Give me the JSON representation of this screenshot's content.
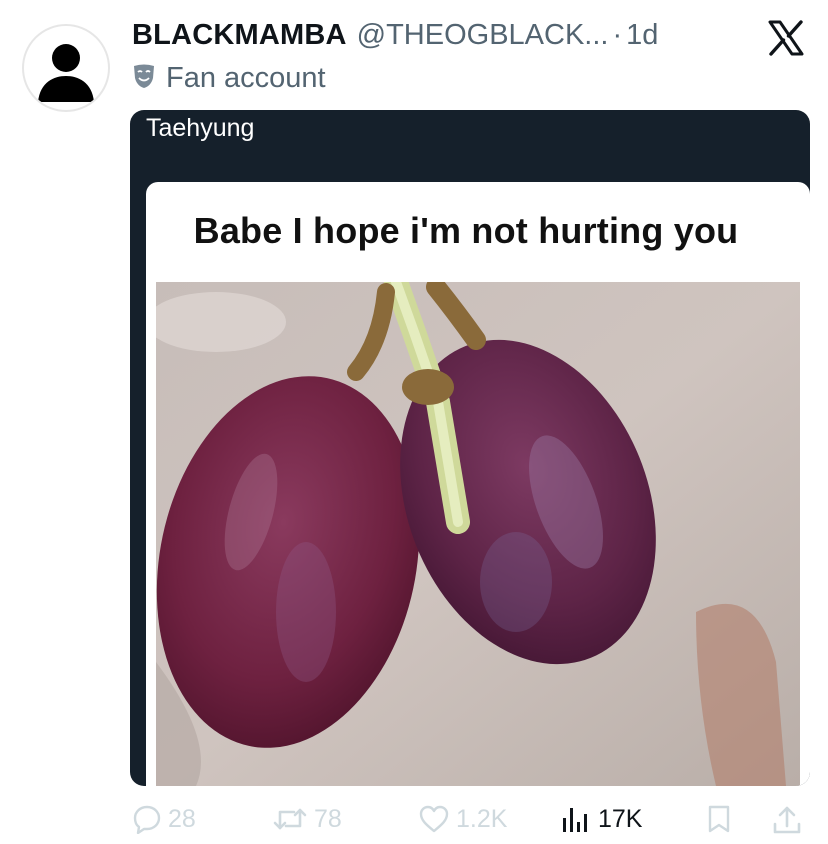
{
  "tweet": {
    "author": {
      "display_name": "BLACKMAMBA",
      "handle": "@THEOGBLACK...",
      "separator": "·",
      "time": "1d",
      "label": "Fan account",
      "label_icon": "theater-mask-icon"
    },
    "platform_icon": "x-logo-icon",
    "quote": {
      "label": "Taehyung",
      "meme_caption": "Babe I hope i'm not hurting you",
      "image": "grapes-photo"
    },
    "actions": {
      "replies": "28",
      "reposts": "78",
      "likes": "1.2K",
      "views": "17K"
    }
  },
  "colors": {
    "text_primary": "#0f1419",
    "text_secondary": "#536471",
    "quote_bg": "#15202b",
    "action_faded": "#cfd9de"
  }
}
